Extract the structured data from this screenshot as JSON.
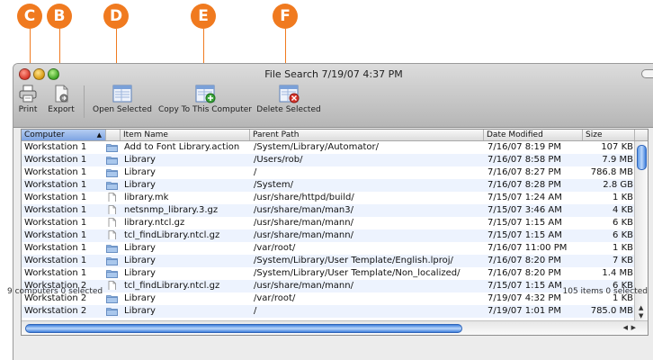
{
  "window": {
    "title": "File Search  7/19/07 4:37 PM"
  },
  "callouts": [
    "C",
    "B",
    "D",
    "E",
    "F"
  ],
  "toolbar": {
    "print": "Print",
    "export": "Export",
    "open_selected": "Open Selected",
    "copy_to_computer": "Copy To This Computer",
    "delete_selected": "Delete Selected"
  },
  "columns": {
    "computer": "Computer",
    "item_name": "Item Name",
    "parent_path": "Parent Path",
    "date_modified": "Date Modified",
    "size": "Size"
  },
  "rows": [
    {
      "computer": "Workstation 1",
      "icon": "folder-icon",
      "name": "Add to Font Library.action",
      "path": "/System/Library/Automator/",
      "date": "7/16/07 8:19 PM",
      "size": "107 KB"
    },
    {
      "computer": "Workstation 1",
      "icon": "folder-icon",
      "name": "Library",
      "path": "/Users/rob/",
      "date": "7/16/07 8:58 PM",
      "size": "7.9 MB"
    },
    {
      "computer": "Workstation 1",
      "icon": "folder-icon",
      "name": "Library",
      "path": "/",
      "date": "7/16/07 8:27 PM",
      "size": "786.8 MB"
    },
    {
      "computer": "Workstation 1",
      "icon": "folder-icon",
      "name": "Library",
      "path": "/System/",
      "date": "7/16/07 8:28 PM",
      "size": "2.8 GB"
    },
    {
      "computer": "Workstation 1",
      "icon": "document-icon",
      "name": "library.mk",
      "path": "/usr/share/httpd/build/",
      "date": "7/15/07 1:24 AM",
      "size": "1 KB"
    },
    {
      "computer": "Workstation 1",
      "icon": "document-icon",
      "name": "netsnmp_library.3.gz",
      "path": "/usr/share/man/man3/",
      "date": "7/15/07 3:46 AM",
      "size": "4 KB"
    },
    {
      "computer": "Workstation 1",
      "icon": "document-icon",
      "name": "library.ntcl.gz",
      "path": "/usr/share/man/mann/",
      "date": "7/15/07 1:15 AM",
      "size": "6 KB"
    },
    {
      "computer": "Workstation 1",
      "icon": "document-icon",
      "name": "tcl_findLibrary.ntcl.gz",
      "path": "/usr/share/man/mann/",
      "date": "7/15/07 1:15 AM",
      "size": "6 KB"
    },
    {
      "computer": "Workstation 1",
      "icon": "folder-icon",
      "name": "Library",
      "path": "/var/root/",
      "date": "7/16/07 11:00 PM",
      "size": "1 KB"
    },
    {
      "computer": "Workstation 1",
      "icon": "folder-icon",
      "name": "Library",
      "path": "/System/Library/User Template/English.lproj/",
      "date": "7/16/07 8:20 PM",
      "size": "7 KB"
    },
    {
      "computer": "Workstation 1",
      "icon": "folder-icon",
      "name": "Library",
      "path": "/System/Library/User Template/Non_localized/",
      "date": "7/16/07 8:20 PM",
      "size": "1.4 MB"
    },
    {
      "computer": "Workstation 2",
      "icon": "document-icon",
      "name": "tcl_findLibrary.ntcl.gz",
      "path": "/usr/share/man/mann/",
      "date": "7/15/07 1:15 AM",
      "size": "6 KB"
    },
    {
      "computer": "Workstation 2",
      "icon": "folder-icon",
      "name": "Library",
      "path": "/var/root/",
      "date": "7/19/07 4:32 PM",
      "size": "1 KB"
    },
    {
      "computer": "Workstation 2",
      "icon": "folder-icon",
      "name": "Library",
      "path": "/",
      "date": "7/19/07 1:01 PM",
      "size": "785.0 MB"
    }
  ],
  "status": {
    "left": "9 computers   0 selected",
    "right": "105 items   0 selected"
  },
  "colors": {
    "callout": "#f07a1f",
    "sorted_header": "#7ea4e2",
    "row_stripe": "#edf3fe"
  }
}
